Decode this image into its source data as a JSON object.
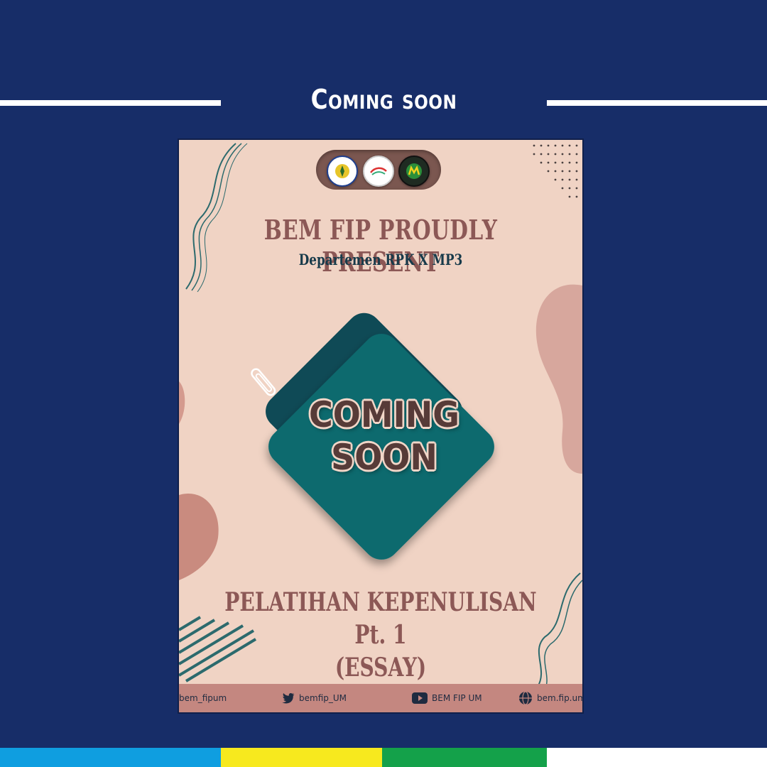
{
  "header": {
    "title": "Coming soon"
  },
  "poster": {
    "present_title": "BEM FIP PROUDLY PRESENT",
    "department": "Departemen RPK X MP3",
    "card_line1": "COMING",
    "card_line2": "SOON",
    "event_line1": "PELATIHAN KEPENULISAN Pt. 1",
    "event_line2": "(ESSAY)",
    "footer": {
      "instagram": "bem_fipum",
      "twitter": "bemfip_UM",
      "youtube": "BEM FIP UM",
      "website": "bem.fip.um.ac"
    }
  },
  "colors": {
    "background": "#172d68",
    "poster_bg": "#f0d3c4",
    "teal_card": "#0c6a6e",
    "dark_card": "#0f4a56",
    "accent_text": "#8c5856",
    "strip_blue": "#0f9ee0",
    "strip_yellow": "#f7e91e",
    "strip_green": "#14a14a",
    "strip_white": "#ffffff"
  },
  "icons": [
    "paperclip-icon",
    "twitter-icon",
    "youtube-icon",
    "globe-icon"
  ]
}
